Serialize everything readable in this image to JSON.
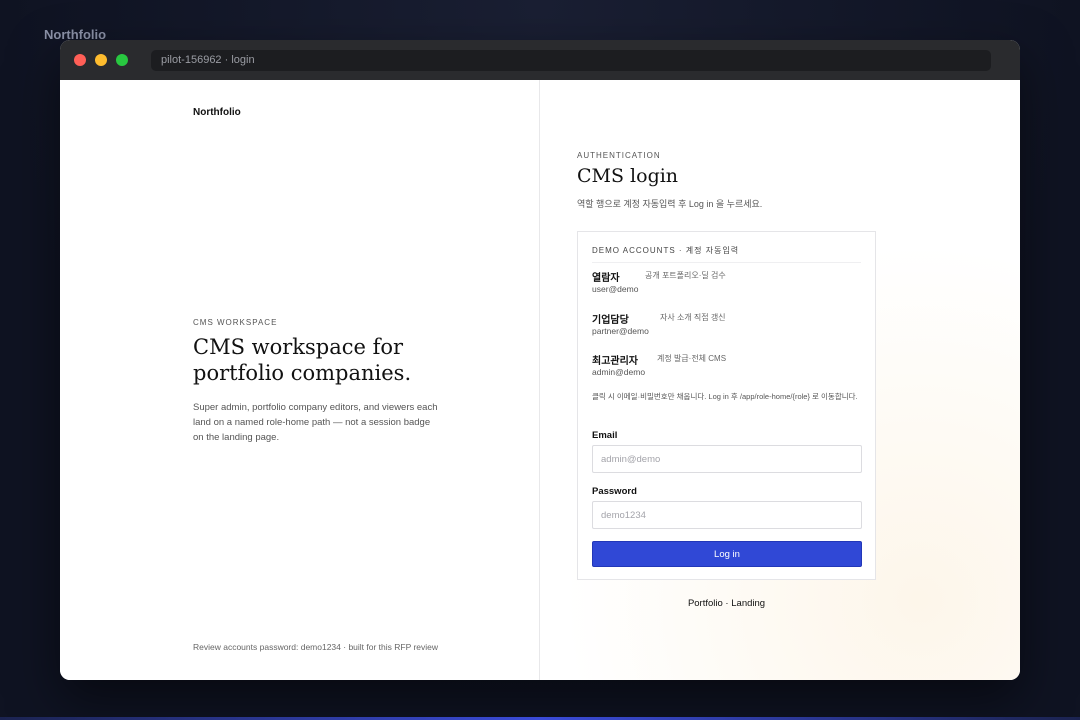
{
  "desktop": {
    "app_label": "Northfolio"
  },
  "window": {
    "address": "pilot-156962 · login"
  },
  "left": {
    "brand": "Northfolio",
    "kicker": "CMS WORKSPACE",
    "title": "CMS workspace for portfolio companies.",
    "description": "Super admin, portfolio company editors, and viewers each land on a named role-home path — not a session badge on the landing page.",
    "footer_note": "Review accounts password: demo1234 · built for this RFP review"
  },
  "auth": {
    "kicker": "AUTHENTICATION",
    "title": "CMS login",
    "subtitle": "역할 행으로 계정 자동입력 후 Log in 을 누르세요."
  },
  "demo": {
    "header": "DEMO ACCOUNTS · 계정 자동입력",
    "accounts": [
      {
        "role": "열람자",
        "desc": "공개 포트폴리오·딜 검수",
        "email": "user@demo"
      },
      {
        "role": "기업담당",
        "desc": "자사 소개 직접 갱신",
        "email": "partner@demo"
      },
      {
        "role": "최고관리자",
        "desc": "계정 발급·전체 CMS",
        "email": "admin@demo"
      }
    ],
    "hint": "클릭 시 이메일·비밀번호만 채웁니다. Log in 후 /app/role-home/{role} 로 이동합니다."
  },
  "form": {
    "email_label": "Email",
    "email_placeholder": "admin@demo",
    "password_label": "Password",
    "password_placeholder": "demo1234",
    "submit": "Log in"
  },
  "links": {
    "portfolio": "Portfolio",
    "separator": " · ",
    "landing": "Landing"
  },
  "colors": {
    "accent": "#3048d6",
    "traffic_red": "#ff5f57",
    "traffic_yellow": "#febc2e",
    "traffic_green": "#28c840"
  }
}
